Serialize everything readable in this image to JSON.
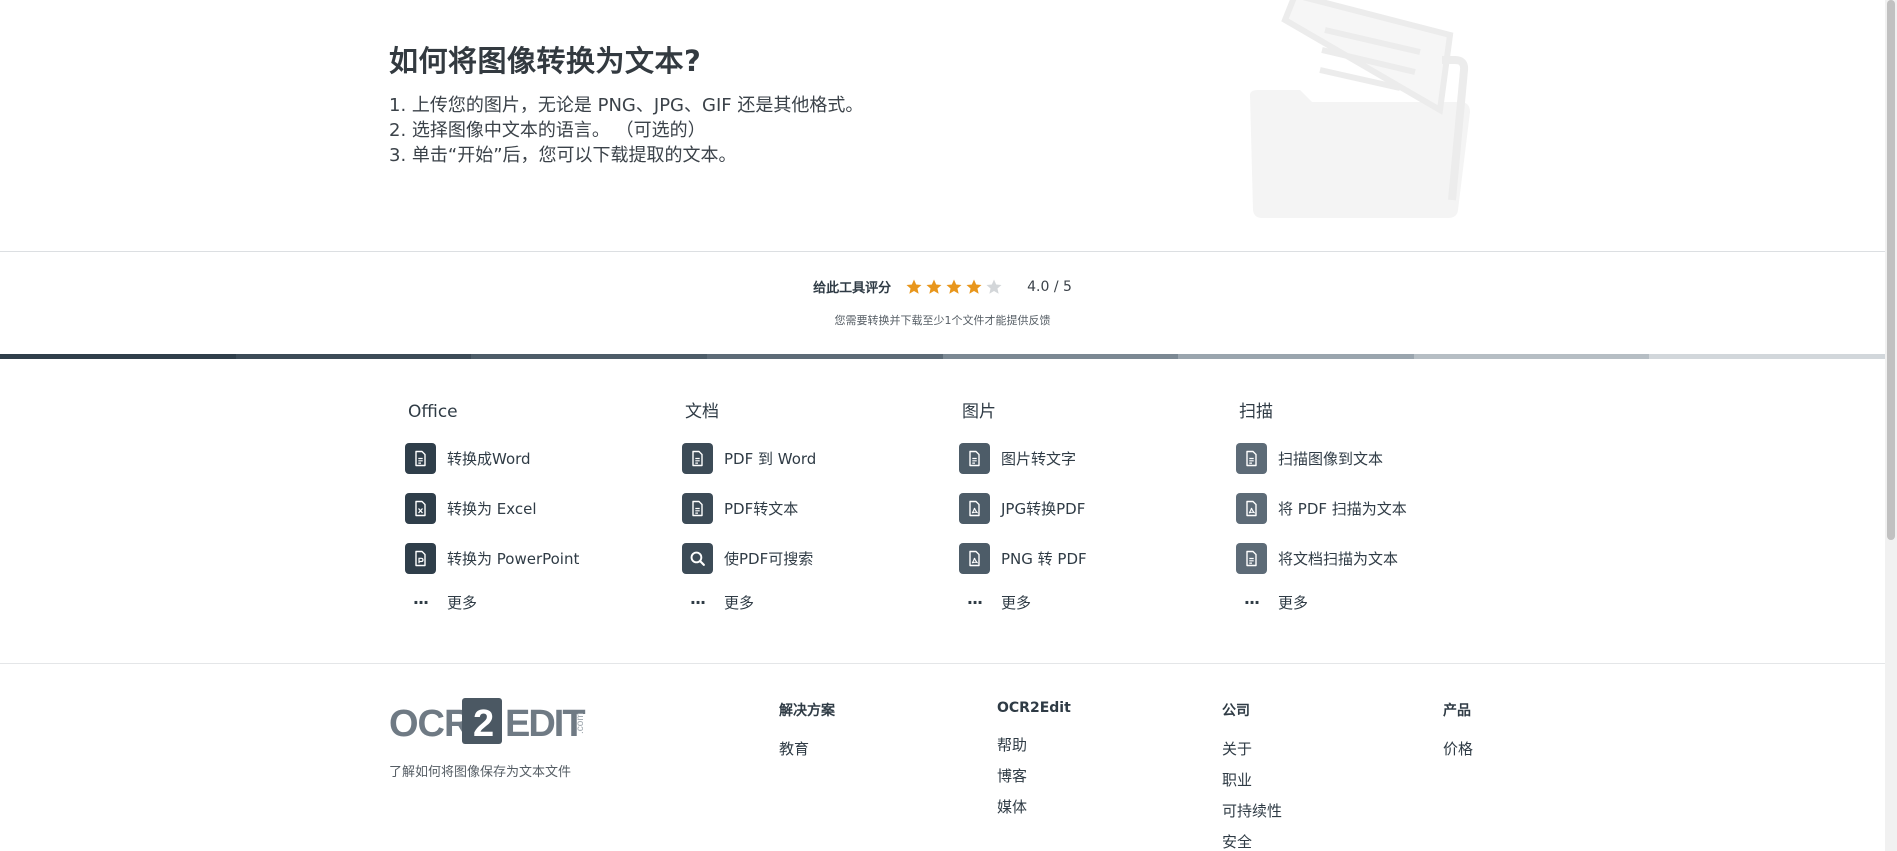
{
  "howto": {
    "title": "如何将图像转换为文本?",
    "steps": [
      "1. 上传您的图片，无论是 PNG、JPG、GIF 还是其他格式。",
      "2. 选择图像中文本的语言。 （可选的）",
      "3. 单击“开始”后，您可以下载提取的文本。"
    ]
  },
  "rating": {
    "label": "给此工具评分",
    "score": "4.0 / 5",
    "value": 4.0,
    "max": 5,
    "note": "您需要转换并下载至少1个文件才能提供反馈",
    "star_color": "#e8961c",
    "star_empty_color": "#d3d6d9"
  },
  "tools": {
    "columns": [
      {
        "title": "Office",
        "tile_color": "#2f3e4a",
        "items": [
          {
            "label": "转换成Word",
            "icon": "file-word-icon"
          },
          {
            "label": "转换为 Excel",
            "icon": "file-excel-icon"
          },
          {
            "label": "转换为 PowerPoint",
            "icon": "file-powerpoint-icon"
          }
        ],
        "more": "更多"
      },
      {
        "title": "文档",
        "tile_color": "#3c4b57",
        "items": [
          {
            "label": "PDF 到 Word",
            "icon": "file-doc-icon"
          },
          {
            "label": "PDF转文本",
            "icon": "file-text-icon"
          },
          {
            "label": "使PDF可搜索",
            "icon": "search-icon"
          }
        ],
        "more": "更多"
      },
      {
        "title": "图片",
        "tile_color": "#4d5c68",
        "items": [
          {
            "label": "图片转文字",
            "icon": "file-text-icon"
          },
          {
            "label": "JPG转换PDF",
            "icon": "file-pdf-icon"
          },
          {
            "label": "PNG 转 PDF",
            "icon": "file-pdf-icon"
          }
        ],
        "more": "更多"
      },
      {
        "title": "扫描",
        "tile_color": "#5d6b77",
        "items": [
          {
            "label": "扫描图像到文本",
            "icon": "file-text-icon"
          },
          {
            "label": "将 PDF 扫描为文本",
            "icon": "file-pdf-icon"
          },
          {
            "label": "将文档扫描为文本",
            "icon": "file-text-icon"
          }
        ],
        "more": "更多"
      }
    ]
  },
  "footer": {
    "logo": {
      "left": "OCR",
      "box": "2",
      "right": "EDIT",
      "suffix": ".com"
    },
    "tagline": "了解如何将图像保存为文本文件",
    "columns": [
      {
        "title": "解决方案",
        "links": [
          "教育"
        ]
      },
      {
        "title": "OCR2Edit",
        "links": [
          "帮助",
          "博客",
          "媒体"
        ]
      },
      {
        "title": "公司",
        "links": [
          "关于",
          "职业",
          "可持续性",
          "安全"
        ]
      },
      {
        "title": "产品",
        "links": [
          "价格"
        ]
      }
    ]
  },
  "colors": {
    "gradient": [
      "#2f3e4a",
      "#3c4b57",
      "#4d5c68",
      "#5d6b77",
      "#7b8893",
      "#9aa5ae",
      "#b6bec4",
      "#d2d7db"
    ]
  }
}
